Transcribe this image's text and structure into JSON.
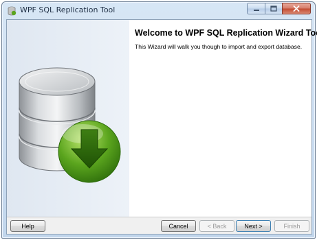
{
  "window": {
    "title": "WPF SQL Replication Tool",
    "icons": [
      "app-icon",
      "minimize-icon",
      "maximize-icon",
      "close-icon",
      "database-download-icon"
    ]
  },
  "content": {
    "heading": "Welcome to WPF SQL Replication Wizard Tool",
    "description": "This Wizard will walk you though to import and export database."
  },
  "buttons": {
    "help": "Help",
    "cancel": "Cancel",
    "back": "< Back",
    "next": "Next >",
    "finish": "Finish"
  },
  "state": {
    "back_enabled": false,
    "finish_enabled": false
  },
  "colors": {
    "left_pane": "#e6edf5",
    "arrow_green": "#5aa51f",
    "database_gray": "#bfc3c7"
  }
}
